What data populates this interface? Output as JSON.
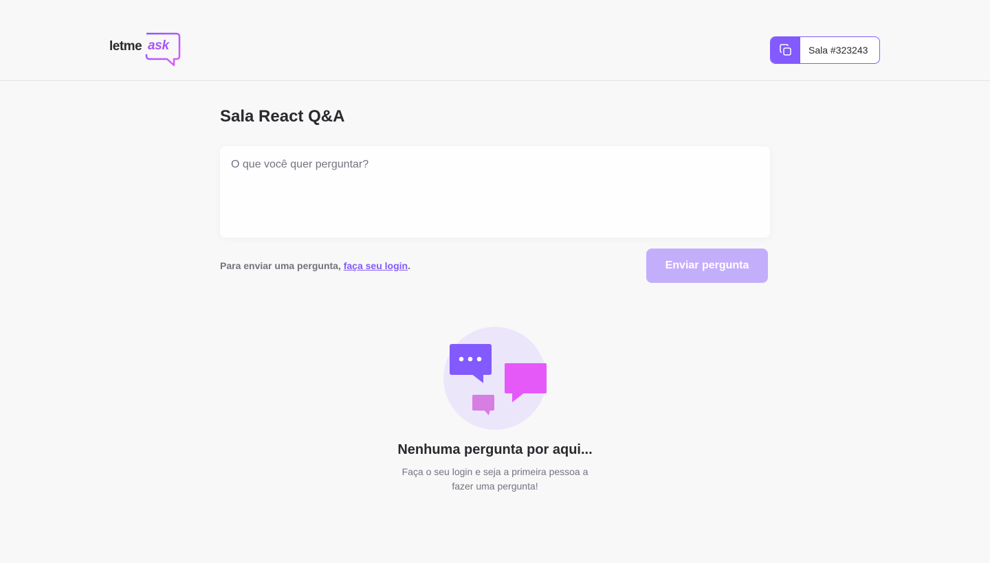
{
  "header": {
    "logo_text_left": "letme",
    "logo_text_right": "ask",
    "room_code_label": "Sala #323243",
    "copy_icon": "copy-icon"
  },
  "room": {
    "title": "Sala React Q&A"
  },
  "form": {
    "placeholder": "O que você quer perguntar?",
    "value": "",
    "login_hint_prefix": "Para enviar uma pergunta, ",
    "login_link": "faça seu login",
    "login_hint_suffix": ".",
    "submit_label": "Enviar pergunta"
  },
  "empty_state": {
    "icon": "chat-bubbles-icon",
    "title": "Nenhuma pergunta por aqui...",
    "description": "Faça o seu login e seja a primeira pessoa a fazer uma pergunta!"
  },
  "colors": {
    "accent": "#835afd",
    "accent_disabled": "#c3aefc",
    "pink": "#e559f9",
    "background": "#f8f8f8"
  }
}
